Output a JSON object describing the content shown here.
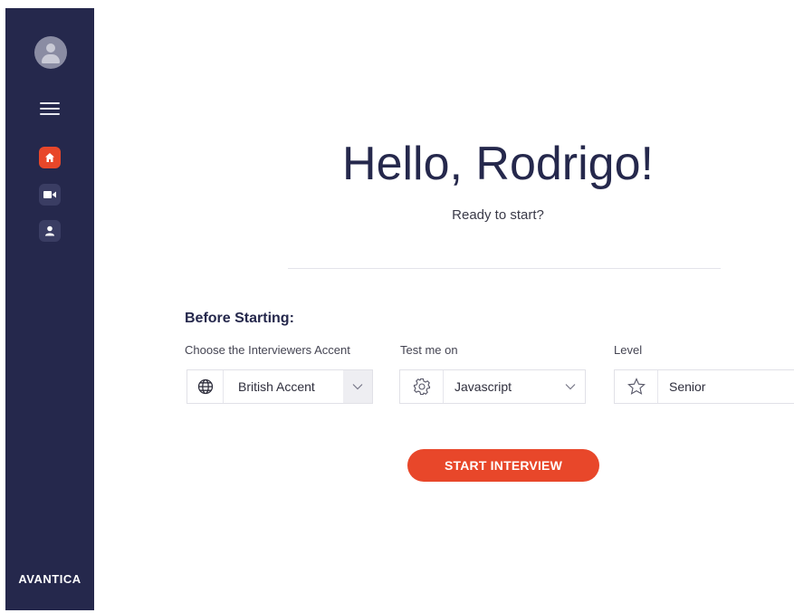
{
  "sidebar": {
    "logo": "AVANTICA",
    "nav": [
      {
        "icon": "home-icon",
        "active": true
      },
      {
        "icon": "video-camera-icon",
        "active": false
      },
      {
        "icon": "user-icon",
        "active": false
      }
    ]
  },
  "main": {
    "greeting": "Hello, Rodrigo!",
    "subtitle": "Ready to start?",
    "section_title": "Before Starting:",
    "accent": {
      "label": "Choose the Interviewers Accent",
      "value": "British Accent",
      "icon": "globe-icon"
    },
    "test": {
      "label": "Test me on",
      "value": "Javascript",
      "icon": "gear-icon"
    },
    "level": {
      "label": "Level",
      "value": "Senior",
      "icon": "star-icon"
    },
    "start_button": "START INTERVIEW"
  },
  "colors": {
    "sidebar_bg": "#25284c",
    "accent": "#e8472a",
    "heading": "#25284c"
  }
}
